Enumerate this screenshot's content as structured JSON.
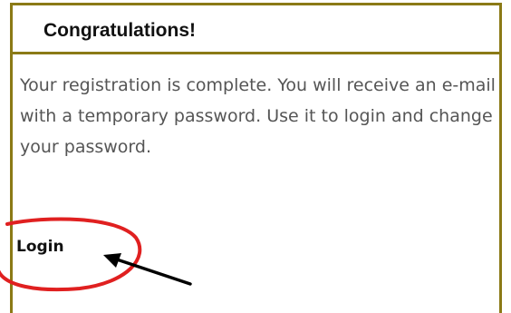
{
  "dialog": {
    "title": "Congratulations!",
    "message": "Your registration is complete. You will receive an e-mail with a temporary password. Use it to login and change your password.",
    "login_label": "Login"
  },
  "colors": {
    "border": "#8b7a16",
    "annotation_red": "#e02020",
    "annotation_arrow": "#000000",
    "text_muted": "#555555"
  }
}
